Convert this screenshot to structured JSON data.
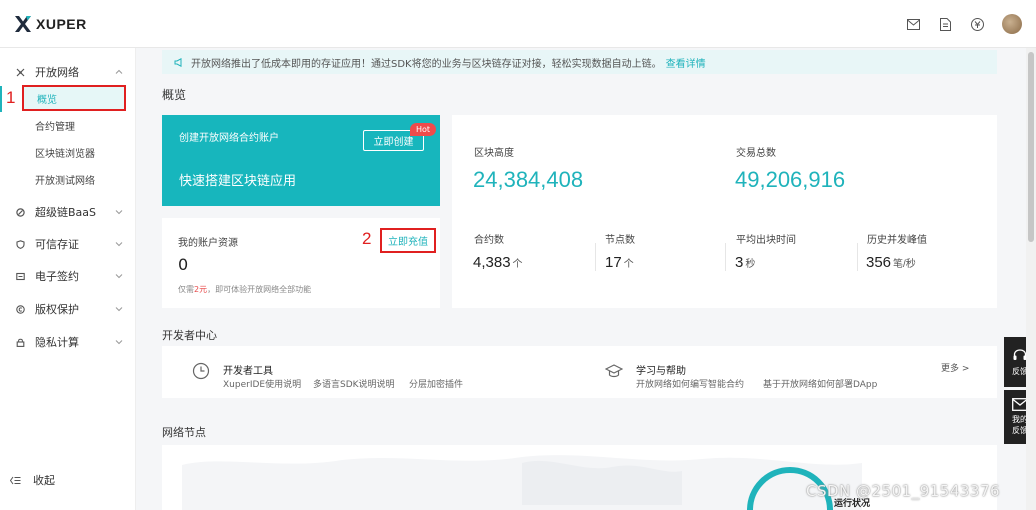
{
  "app": {
    "logo_text": "XUPER"
  },
  "header": {
    "icons": [
      "mail-icon",
      "document-icon",
      "currency-icon",
      "avatar"
    ]
  },
  "sidebar": {
    "groups": [
      {
        "label": "开放网络",
        "icon": "network-icon",
        "expanded": true
      },
      {
        "label": "超级链BaaS",
        "icon": "baas-icon"
      },
      {
        "label": "可信存证",
        "icon": "shield-icon"
      },
      {
        "label": "电子签约",
        "icon": "sign-icon"
      },
      {
        "label": "版权保护",
        "icon": "copyright-icon"
      },
      {
        "label": "隐私计算",
        "icon": "lock-icon"
      }
    ],
    "sub_items": [
      {
        "label": "概览",
        "active": true
      },
      {
        "label": "合约管理"
      },
      {
        "label": "区块链浏览器"
      },
      {
        "label": "开放测试网络"
      }
    ],
    "collapse_label": "收起"
  },
  "annotations": {
    "one": "1",
    "two": "2"
  },
  "notice": {
    "text": "开放网络推出了低成本即用的存证应用！通过SDK将您的业务与区块链存证对接，轻松实现数据自动上链。",
    "link": "查看详情"
  },
  "overview": {
    "title": "概览",
    "promo": {
      "title": "创建开放网络合约账户",
      "button": "立即创建",
      "hot": "Hot",
      "slogan": "快速搭建区块链应用"
    },
    "account": {
      "title": "我的账户资源",
      "value": "0",
      "charge": "立即充值",
      "tip_prefix": "仅需",
      "tip_amount": "2元",
      "tip_suffix": "，即可体验开放网络全部功能"
    },
    "stats": {
      "block_height_label": "区块高度",
      "block_height": "24,384,408",
      "tx_total_label": "交易总数",
      "tx_total": "49,206,916",
      "contracts_label": "合约数",
      "contracts": "4,383",
      "contracts_unit": "个",
      "nodes_label": "节点数",
      "nodes": "17",
      "nodes_unit": "个",
      "block_time_label": "平均出块时间",
      "block_time": "3",
      "block_time_unit": "秒",
      "peak_label": "历史并发峰值",
      "peak": "356",
      "peak_unit": "笔/秒"
    }
  },
  "dev_center": {
    "title": "开发者中心",
    "tools": {
      "title": "开发者工具",
      "links": [
        "XuperIDE使用说明",
        "多语言SDK说明说明",
        "分层加密插件"
      ]
    },
    "learn": {
      "title": "学习与帮助",
      "links": [
        "开放网络如何编写智能合约",
        "基于开放网络如何部署DApp"
      ]
    },
    "more": "更多 >"
  },
  "network": {
    "title": "网络节点",
    "status_label": "运行状况"
  },
  "feedback": {
    "label1": "反馈",
    "label2a": "我的",
    "label2b": "反馈"
  },
  "watermark": "CSDN @2501_91543376",
  "colors": {
    "brand": "#17b6bd",
    "accent_red": "#e02020"
  }
}
